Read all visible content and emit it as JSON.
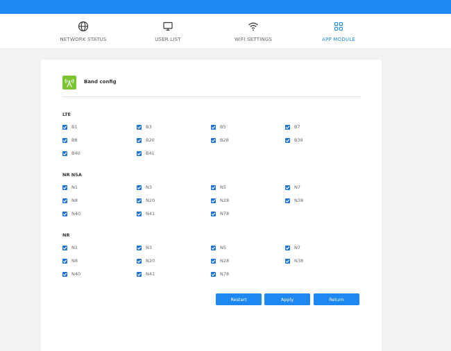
{
  "nav": {
    "items": [
      {
        "label": "NETWORK STATUS"
      },
      {
        "label": "USER LIST"
      },
      {
        "label": "WIFI SETTINGS"
      },
      {
        "label": "APP MODULE",
        "active": true
      }
    ]
  },
  "colors": {
    "primary": "#1e88f0",
    "checkbox": "#1e73d8",
    "band_icon": "#7cc431"
  },
  "card": {
    "title": "Band config",
    "icon": "antenna-icon",
    "sections": [
      {
        "label": "LTE",
        "bands": [
          {
            "label": "B1",
            "checked": true
          },
          {
            "label": "B3",
            "checked": true
          },
          {
            "label": "B5",
            "checked": true
          },
          {
            "label": "B7",
            "checked": true
          },
          {
            "label": "B8",
            "checked": true
          },
          {
            "label": "B20",
            "checked": true
          },
          {
            "label": "B28",
            "checked": true
          },
          {
            "label": "B38",
            "checked": true
          },
          {
            "label": "B40",
            "checked": true
          },
          {
            "label": "B41",
            "checked": true
          }
        ]
      },
      {
        "label": "NR NSA",
        "bands": [
          {
            "label": "N1",
            "checked": true
          },
          {
            "label": "N3",
            "checked": true
          },
          {
            "label": "N5",
            "checked": true
          },
          {
            "label": "N7",
            "checked": true
          },
          {
            "label": "N8",
            "checked": true
          },
          {
            "label": "N20",
            "checked": true
          },
          {
            "label": "N28",
            "checked": true
          },
          {
            "label": "N38",
            "checked": true
          },
          {
            "label": "N40",
            "checked": true
          },
          {
            "label": "N41",
            "checked": true
          },
          {
            "label": "N78",
            "checked": true
          }
        ]
      },
      {
        "label": "NR",
        "bands": [
          {
            "label": "N1",
            "checked": true
          },
          {
            "label": "N3",
            "checked": true
          },
          {
            "label": "N5",
            "checked": true
          },
          {
            "label": "N7",
            "checked": true
          },
          {
            "label": "N8",
            "checked": true
          },
          {
            "label": "N20",
            "checked": true
          },
          {
            "label": "N28",
            "checked": true
          },
          {
            "label": "N38",
            "checked": true
          },
          {
            "label": "N40",
            "checked": true
          },
          {
            "label": "N41",
            "checked": true
          },
          {
            "label": "N78",
            "checked": true
          }
        ]
      }
    ],
    "buttons": {
      "restart": "Restart",
      "apply": "Apply",
      "return": "Return"
    }
  }
}
